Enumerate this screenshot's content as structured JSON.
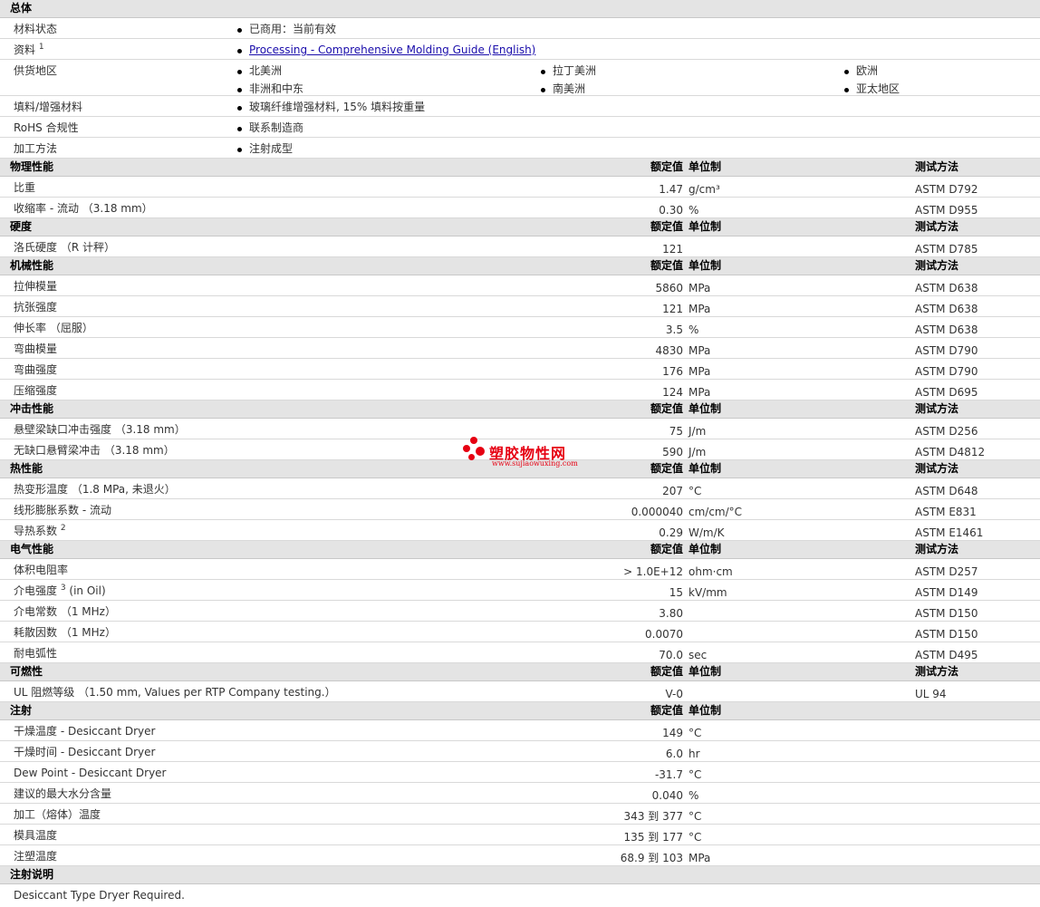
{
  "general": {
    "title": "总体",
    "rows": [
      {
        "label": "材料状态",
        "values": [
          "已商用：当前有效"
        ]
      },
      {
        "label": "资料",
        "sup": "1",
        "values": [
          "Processing - Comprehensive Molding Guide (English)"
        ],
        "link": true
      },
      {
        "label": "供货地区",
        "values": [
          "北美洲",
          "拉丁美洲",
          "欧洲",
          "非洲和中东",
          "南美洲",
          "亚太地区"
        ]
      },
      {
        "label": "填料/增强材料",
        "values": [
          "玻璃纤维增强材料, 15% 填料按重量"
        ]
      },
      {
        "label": "RoHS 合规性",
        "values": [
          "联系制造商"
        ]
      },
      {
        "label": "加工方法",
        "values": [
          "注射成型"
        ]
      }
    ]
  },
  "column_headers": {
    "value": "额定值",
    "unit": "单位制",
    "method": "测试方法"
  },
  "sections": [
    {
      "title": "物理性能",
      "rows": [
        {
          "label": "比重",
          "value": "1.47",
          "unit": "g/cm³",
          "method": "ASTM D792"
        },
        {
          "label": "收缩率  - 流动 （3.18 mm）",
          "value": "0.30",
          "unit": "%",
          "method": "ASTM D955"
        }
      ]
    },
    {
      "title": "硬度",
      "rows": [
        {
          "label": "洛氏硬度 （R 计秤）",
          "value": "121",
          "unit": "",
          "method": "ASTM D785"
        }
      ]
    },
    {
      "title": "机械性能",
      "rows": [
        {
          "label": "拉伸模量",
          "value": "5860",
          "unit": "MPa",
          "method": "ASTM D638"
        },
        {
          "label": "抗张强度",
          "value": "121",
          "unit": "MPa",
          "method": "ASTM D638"
        },
        {
          "label": "伸长率 （屈服）",
          "value": "3.5",
          "unit": "%",
          "method": "ASTM D638"
        },
        {
          "label": "弯曲模量",
          "value": "4830",
          "unit": "MPa",
          "method": "ASTM D790"
        },
        {
          "label": "弯曲强度",
          "value": "176",
          "unit": "MPa",
          "method": "ASTM D790"
        },
        {
          "label": "压缩强度",
          "value": "124",
          "unit": "MPa",
          "method": "ASTM D695"
        }
      ]
    },
    {
      "title": "冲击性能",
      "rows": [
        {
          "label": "悬壁梁缺口冲击强度 （3.18 mm）",
          "value": "75",
          "unit": "J/m",
          "method": "ASTM D256"
        },
        {
          "label": "无缺口悬臂梁冲击 （3.18 mm）",
          "value": "590",
          "unit": "J/m",
          "method": "ASTM D4812"
        }
      ]
    },
    {
      "title": "热性能",
      "rows": [
        {
          "label": "热变形温度 （1.8 MPa, 未退火）",
          "value": "207",
          "unit": "°C",
          "method": "ASTM D648"
        },
        {
          "label": "线形膨胀系数  - 流动",
          "value": "0.000040",
          "unit": "cm/cm/°C",
          "method": "ASTM E831"
        },
        {
          "label": "导热系数",
          "sup": "2",
          "value": "0.29",
          "unit": "W/m/K",
          "method": "ASTM E1461"
        }
      ]
    },
    {
      "title": "电气性能",
      "rows": [
        {
          "label": "体积电阻率",
          "value": "> 1.0E+12",
          "unit": "ohm·cm",
          "method": "ASTM D257"
        },
        {
          "label": "介电强度",
          "sup": "3",
          "suffix": " (in Oil)",
          "value": "15",
          "unit": "kV/mm",
          "method": "ASTM D149"
        },
        {
          "label": "介电常数 （1 MHz）",
          "value": "3.80",
          "unit": "",
          "method": "ASTM D150"
        },
        {
          "label": "耗散因数 （1 MHz）",
          "value": "0.0070",
          "unit": "",
          "method": "ASTM D150"
        },
        {
          "label": "耐电弧性",
          "value": "70.0",
          "unit": "sec",
          "method": "ASTM D495"
        }
      ]
    },
    {
      "title": "可燃性",
      "rows": [
        {
          "label": "UL 阻燃等级 （1.50 mm, Values per RTP Company testing.）",
          "value": "V-0",
          "unit": "",
          "method": "UL 94"
        }
      ]
    },
    {
      "title": "注射",
      "show_method": false,
      "rows": [
        {
          "label": "干燥温度  - Desiccant Dryer",
          "value": "149",
          "unit": "°C",
          "method": ""
        },
        {
          "label": "干燥时间  - Desiccant Dryer",
          "value": "6.0",
          "unit": "hr",
          "method": ""
        },
        {
          "label": "Dew Point - Desiccant Dryer",
          "value": "-31.7",
          "unit": "°C",
          "method": ""
        },
        {
          "label": "建议的最大水分含量",
          "value": "0.040",
          "unit": "%",
          "method": ""
        },
        {
          "label": "加工（熔体）温度",
          "value": "343 到  377",
          "unit": "°C",
          "method": ""
        },
        {
          "label": "模具温度",
          "value": "135 到  177",
          "unit": "°C",
          "method": ""
        },
        {
          "label": "注塑温度",
          "value": "68.9 到  103",
          "unit": "MPa",
          "method": ""
        }
      ]
    }
  ],
  "notes": {
    "title": "注射说明",
    "text": "Desiccant Type Dryer Required."
  },
  "watermark": {
    "main": "塑胶物性网",
    "sub": "www.sujiaowuxing.com",
    "color": "#e60012"
  }
}
